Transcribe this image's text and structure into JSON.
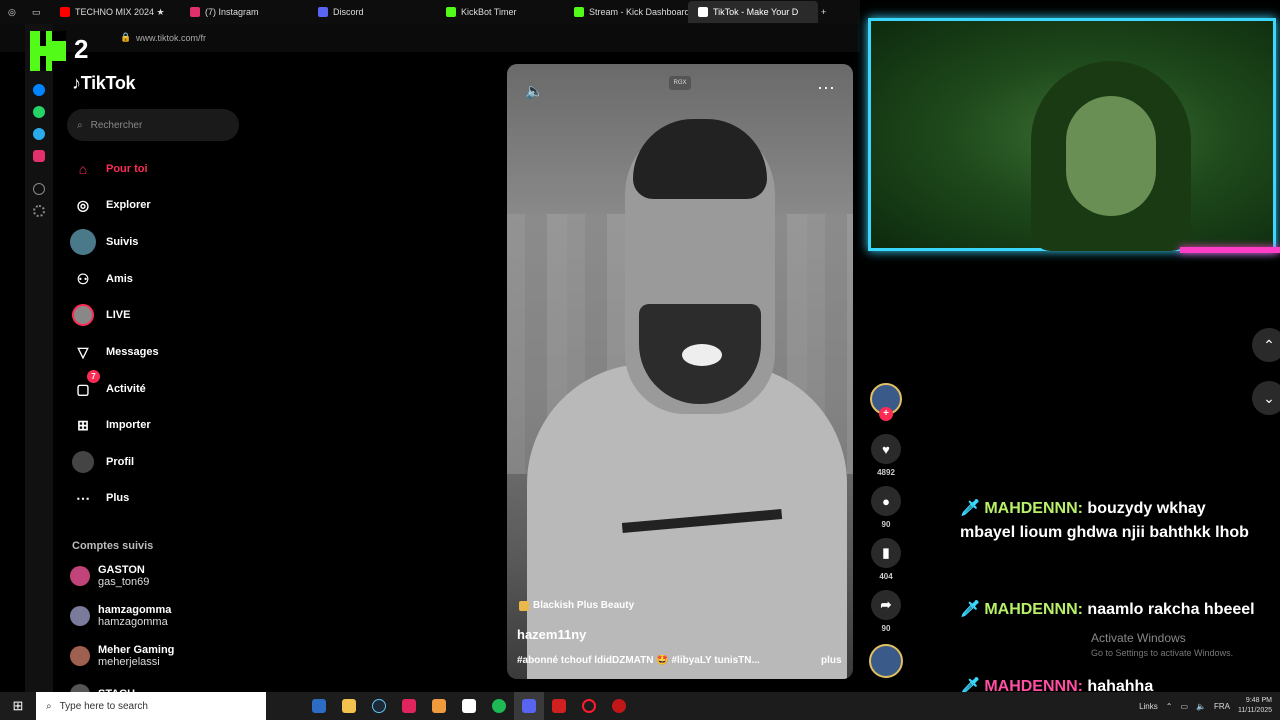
{
  "browser": {
    "tabs": [
      {
        "label": "TECHNO MIX 2024 ★",
        "color": "#ff0000"
      },
      {
        "label": "(7) Instagram",
        "color": "#e1306c"
      },
      {
        "label": "Discord",
        "color": "#5865f2"
      },
      {
        "label": "KickBot Timer",
        "color": "#53fc18"
      },
      {
        "label": "Stream - Kick Dashboard",
        "color": "#53fc18"
      },
      {
        "label": "TikTok - Make Your D",
        "color": "#ffffff"
      }
    ],
    "url": "www.tiktok.com/fr"
  },
  "overlay": {
    "kick_number": "2"
  },
  "tiktok": {
    "logo": "TikTok",
    "search_placeholder": "Rechercher",
    "nav": [
      {
        "label": "Pour toi",
        "icon": "home-icon"
      },
      {
        "label": "Explorer",
        "icon": "compass-icon"
      },
      {
        "label": "Suivis",
        "icon": "following-avatar"
      },
      {
        "label": "Amis",
        "icon": "friends-icon"
      },
      {
        "label": "LIVE",
        "icon": "live-icon"
      },
      {
        "label": "Messages",
        "icon": "message-icon"
      },
      {
        "label": "Activité",
        "icon": "activity-icon",
        "badge": "7"
      },
      {
        "label": "Importer",
        "icon": "upload-icon"
      },
      {
        "label": "Profil",
        "icon": "profile-avatar"
      },
      {
        "label": "Plus",
        "icon": "more-icon"
      }
    ],
    "following_title": "Comptes suivis",
    "following": [
      {
        "name": "GASTON",
        "handle": "gas_ton69"
      },
      {
        "name": "hamzagomma",
        "handle": "hamzagomma"
      },
      {
        "name": "Meher Gaming",
        "handle": "meherjelassi"
      },
      {
        "name": "STACH",
        "handle": ""
      }
    ]
  },
  "video": {
    "badge": "RGX",
    "music": "Blackish Plus Beauty",
    "username": "hazem11ny",
    "caption": "#abonné tchouf ldidDZMATN 🤩 #libyaLY tunisTN...",
    "more_label": "plus",
    "likes": "4892",
    "comments": "90",
    "saves": "404",
    "shares": "90"
  },
  "chat": [
    {
      "user": "MAHDENNN:",
      "message": "bouzydy wkhay mbayel lioum ghdwa njii bahthkk lhob",
      "user_color": "#b8f06a"
    },
    {
      "user": "MAHDENNN:",
      "message": "naamlo rakcha hbeeel",
      "user_color": "#b8f06a"
    },
    {
      "user": "MAHDENNN:",
      "message": "hahahha",
      "user_color": "#ff4fa3"
    }
  ],
  "windows_watermark": {
    "title": "Activate Windows",
    "subtitle": "Go to Settings to activate Windows."
  },
  "taskbar": {
    "search_placeholder": "Type here to search",
    "links": "Links",
    "lang": "FRA",
    "time": "9:48 PM",
    "date": "11/11/2025"
  },
  "colors": {
    "accent": "#fe2c55",
    "kick": "#53fc18",
    "cam_border": "#3ad8ff",
    "cam_pink": "#ff3ec8"
  }
}
